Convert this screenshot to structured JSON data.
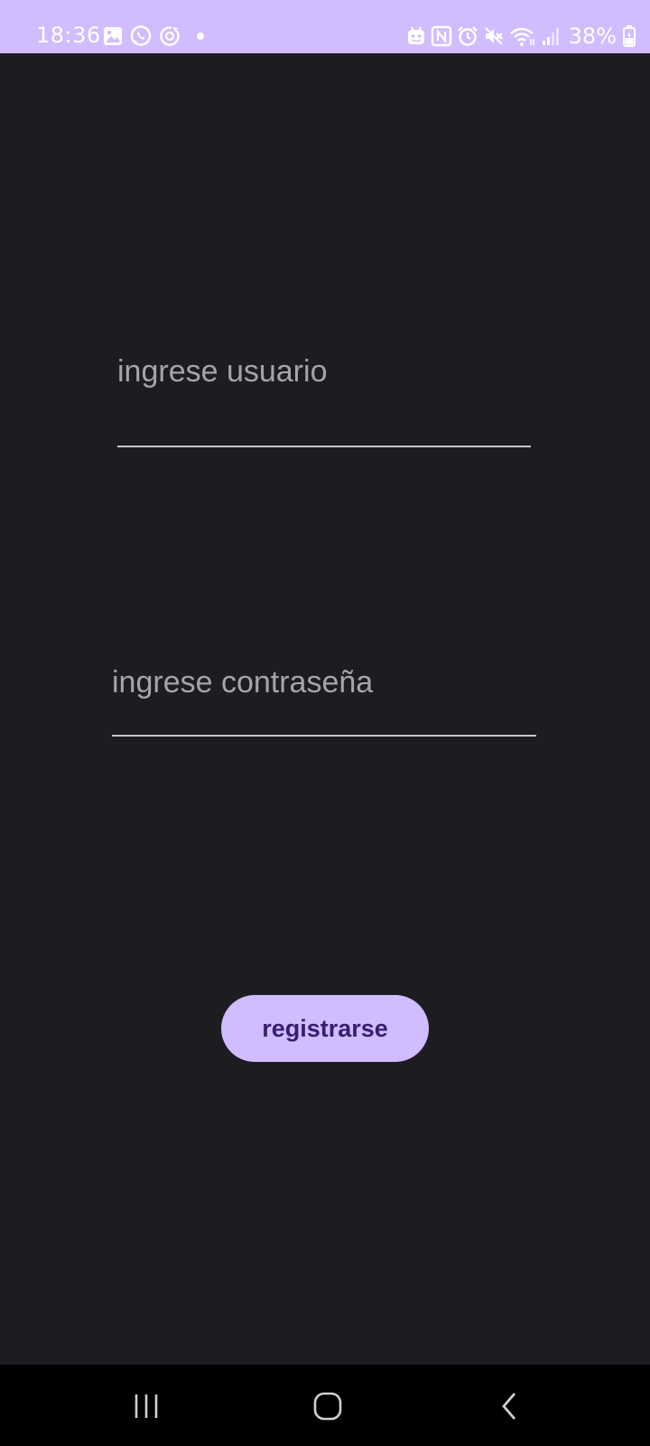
{
  "status_bar": {
    "time": "18:36",
    "battery": "38%",
    "left_icons": [
      "gallery-icon",
      "whatsapp-icon",
      "sync-icon",
      "notification-dot-icon"
    ],
    "right_icons": [
      "android-icon",
      "nfc-icon",
      "alarm-icon",
      "mute-icon",
      "wifi-icon",
      "signal-icon",
      "battery-icon"
    ]
  },
  "form": {
    "username_placeholder": "ingrese usuario",
    "password_placeholder": "ingrese contraseña",
    "username_value": "",
    "password_value": ""
  },
  "register_button": {
    "label": "registrarse"
  },
  "nav_bar": {
    "buttons": [
      "recents-icon",
      "home-icon",
      "back-icon"
    ]
  },
  "colors": {
    "accent": "#d0bcff",
    "background": "#1d1c21",
    "button_text": "#381e72",
    "placeholder": "#a6a4ab",
    "underline": "#cac4d0",
    "nav_background": "#000000"
  }
}
